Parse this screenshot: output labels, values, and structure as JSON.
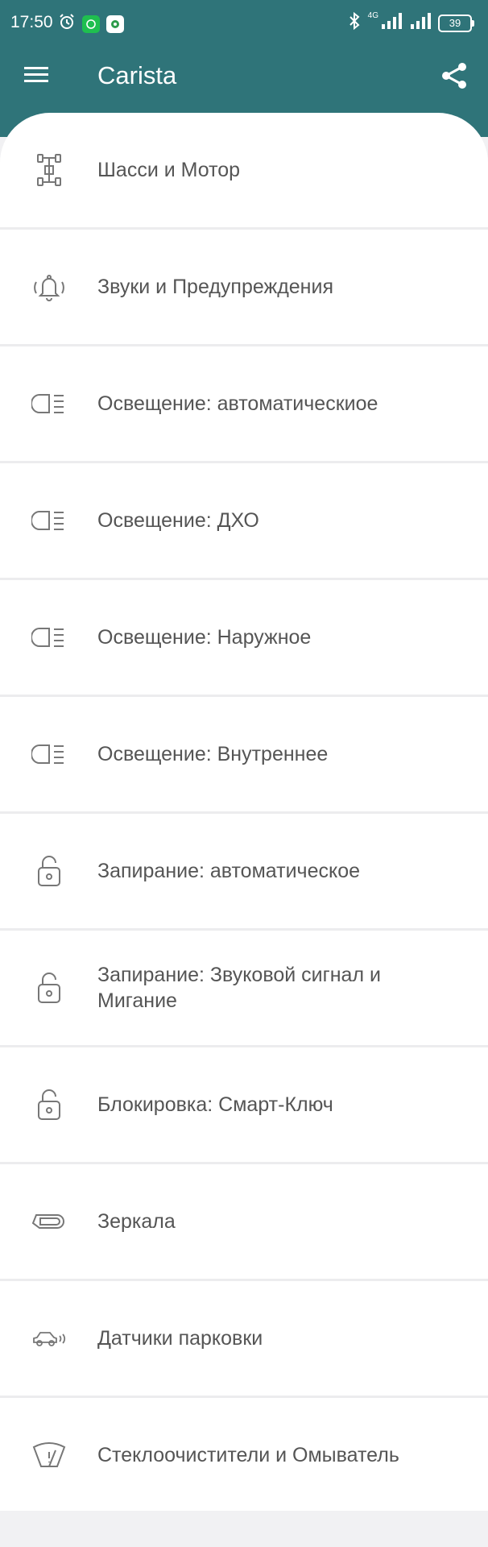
{
  "status_bar": {
    "time": "17:50",
    "network": "4G",
    "battery": "39",
    "icons": [
      "alarm-icon",
      "whatsapp-icon",
      "app-notification-icon",
      "bluetooth-icon",
      "signal-icon",
      "signal-icon",
      "battery-icon"
    ]
  },
  "app_bar": {
    "title": "Carista",
    "menu_icon": "menu-icon",
    "share_icon": "share-icon",
    "background": "#2f7479"
  },
  "list": {
    "items": [
      {
        "label": "Шасси и Мотор",
        "icon": "chassis-icon"
      },
      {
        "label": "Звуки и Предупреждения",
        "icon": "bell-icon"
      },
      {
        "label": "Освещение: автоматическиое",
        "icon": "headlight-icon"
      },
      {
        "label": "Освещение: ДХО",
        "icon": "headlight-icon"
      },
      {
        "label": "Освещение: Наружное",
        "icon": "headlight-icon"
      },
      {
        "label": "Освещение: Внутреннее",
        "icon": "headlight-icon"
      },
      {
        "label": "Запирание: автоматическое",
        "icon": "lock-icon"
      },
      {
        "label": "Запирание: Звуковой сигнал и Мигание",
        "icon": "lock-icon"
      },
      {
        "label": "Блокировка: Смарт-Ключ",
        "icon": "lock-icon"
      },
      {
        "label": "Зеркала",
        "icon": "mirror-icon"
      },
      {
        "label": "Датчики парковки",
        "icon": "parking-sensor-icon"
      },
      {
        "label": "Стеклоочистители и Омыватель",
        "icon": "wiper-icon"
      }
    ]
  }
}
